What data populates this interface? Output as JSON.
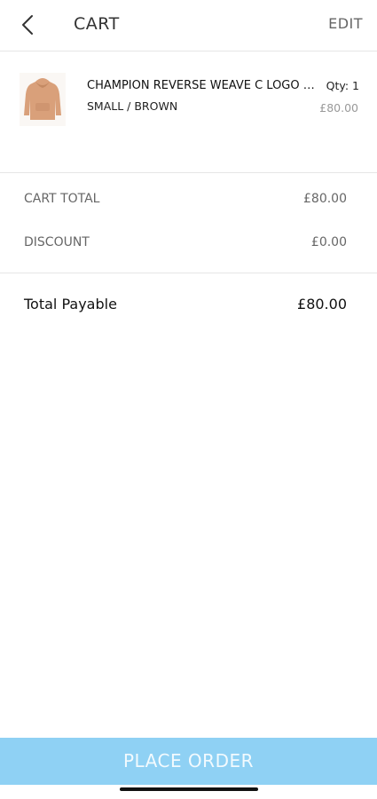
{
  "header": {
    "title": "CART",
    "edit_label": "EDIT",
    "back_icon": "chevron-left-icon"
  },
  "cart": {
    "items": [
      {
        "name": "CHAMPION REVERSE WEAVE C LOGO HOODIE",
        "variant": "SMALL / BROWN",
        "qty": "Qty: 1",
        "price": "£80.00",
        "thumb_icon": "hoodie-image",
        "thumb_color": "#d9a07a"
      }
    ]
  },
  "summary": {
    "cart_total_label": "CART TOTAL",
    "cart_total_value": "£80.00",
    "discount_label": "DISCOUNT",
    "discount_value": "£0.00"
  },
  "payable": {
    "label": "Total Payable",
    "value": "£80.00"
  },
  "footer": {
    "place_order_label": "PLACE ORDER",
    "button_color": "#8fd1f4"
  }
}
